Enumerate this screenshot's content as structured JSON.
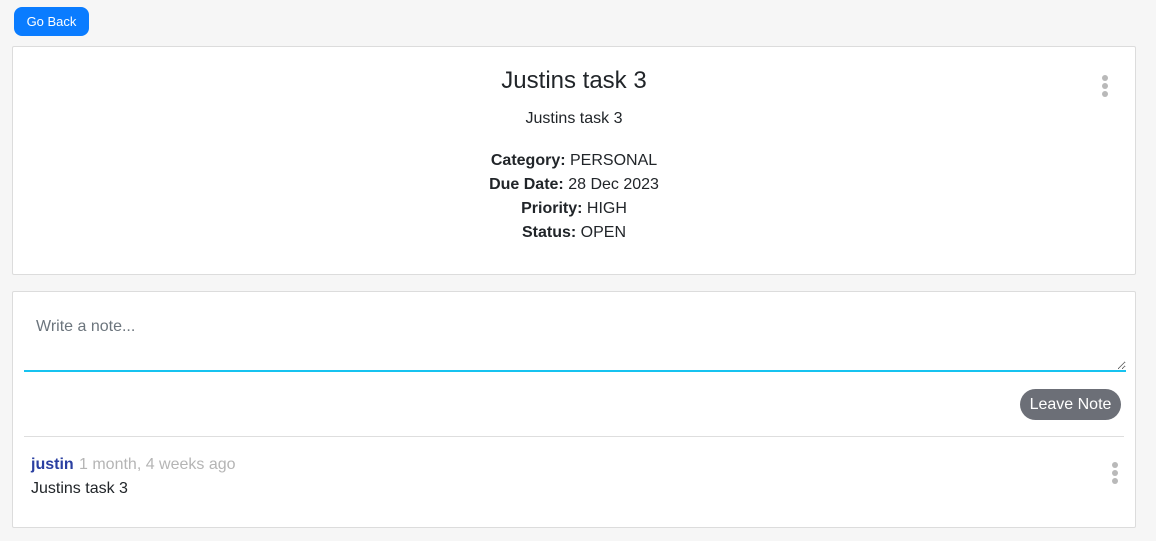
{
  "header": {
    "go_back_label": "Go Back"
  },
  "task": {
    "title": "Justins task 3",
    "description": "Justins task 3",
    "fields": {
      "category_label": "Category:",
      "category_value": "PERSONAL",
      "due_date_label": "Due Date:",
      "due_date_value": "28 Dec 2023",
      "priority_label": "Priority:",
      "priority_value": "HIGH",
      "status_label": "Status:",
      "status_value": "OPEN"
    },
    "menu_icon": "kebab-vertical-icon"
  },
  "notes": {
    "input_placeholder": "Write a note...",
    "input_value": "",
    "leave_note_label": "Leave Note",
    "items": [
      {
        "author": "justin",
        "time": "1 month, 4 weeks ago",
        "text": "Justins task 3",
        "menu_icon": "kebab-vertical-icon"
      }
    ]
  },
  "colors": {
    "primary": "#0a7cff",
    "input_focus": "#17c3f0",
    "secondary_button": "#6c6f77",
    "author_link": "#2a3fa1",
    "muted_text": "#b5b5b5"
  }
}
